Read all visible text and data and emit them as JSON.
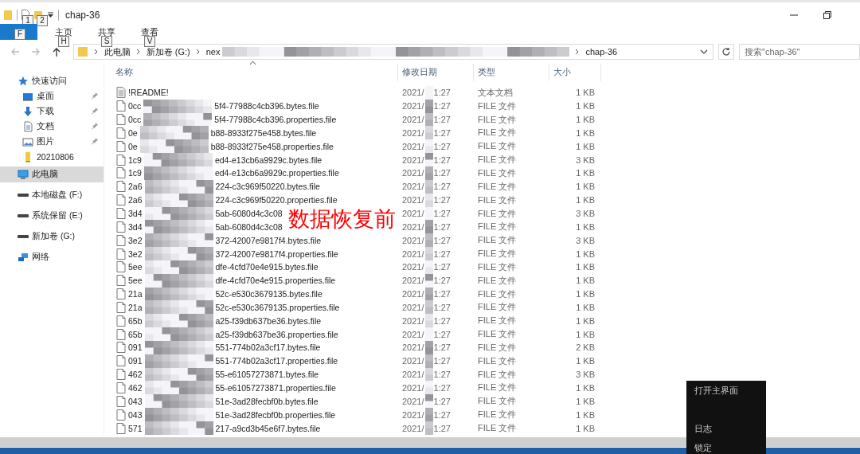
{
  "window": {
    "title": "chap-36",
    "quick_access_tips": [
      "1",
      "2"
    ]
  },
  "ribbon": {
    "tabs": [
      {
        "kind": "file",
        "key_tip": "F"
      },
      {
        "kind": "tab",
        "label": "主页",
        "key_tip": "H"
      },
      {
        "kind": "tab",
        "label": "共享",
        "key_tip": "S"
      },
      {
        "kind": "tab",
        "label": "查看",
        "key_tip": "V"
      }
    ]
  },
  "address": {
    "segments": [
      {
        "kind": "crumb",
        "label": "此电脑"
      },
      {
        "kind": "crumb",
        "label": "新加卷 (G:)"
      },
      {
        "kind": "cut",
        "label": "nex"
      },
      {
        "kind": "crumb",
        "label": "chap-36"
      }
    ],
    "search": {
      "placeholder": "搜索\"chap-36\""
    }
  },
  "sidebar": {
    "items": [
      {
        "kind": "star",
        "label": "快速访问",
        "pinned": false,
        "selected": false
      },
      {
        "kind": "desktop",
        "label": "桌面",
        "pinned": true,
        "selected": false
      },
      {
        "kind": "download",
        "label": "下载",
        "pinned": true,
        "selected": false
      },
      {
        "kind": "document",
        "label": "文档",
        "pinned": true,
        "selected": false
      },
      {
        "kind": "picture",
        "label": "图片",
        "pinned": true,
        "selected": false
      },
      {
        "kind": "folder",
        "label": "20210806",
        "pinned": false,
        "selected": false
      },
      {
        "kind": "pc",
        "label": "此电脑",
        "pinned": false,
        "selected": true
      },
      {
        "kind": "drive",
        "label": "本地磁盘 (F:)",
        "pinned": false,
        "selected": false
      },
      {
        "kind": "drive",
        "label": "系统保留 (E:)",
        "pinned": false,
        "selected": false
      },
      {
        "kind": "drive",
        "label": "新加卷 (G:)",
        "pinned": false,
        "selected": false
      },
      {
        "kind": "network",
        "label": "网络",
        "pinned": false,
        "selected": false
      }
    ]
  },
  "table": {
    "columns": [
      "名称",
      "修改日期",
      "类型",
      "大小"
    ],
    "rows": [
      {
        "kind": "text",
        "name": "!README!",
        "date": "2021/",
        "time": "1:27",
        "type": "文本文档",
        "size": "1 KB"
      },
      {
        "kind": "file",
        "name_start": "0cc",
        "name_end": "5f4-77988c4cb396.bytes.file",
        "date": "2021/",
        "time": "1:27",
        "type": "FILE 文件",
        "size": "1 KB"
      },
      {
        "kind": "file",
        "name_start": "0cc",
        "name_end": "5f4-77988c4cb396.properties.file",
        "date": "2021/",
        "time": "1:27",
        "type": "FILE 文件",
        "size": "1 KB"
      },
      {
        "kind": "file",
        "name_start": "0e",
        "name_end": "b88-8933f275e458.bytes.file",
        "date": "2021/",
        "time": "1:27",
        "type": "FILE 文件",
        "size": "1 KB"
      },
      {
        "kind": "file",
        "name_start": "0e",
        "name_end": "b88-8933f275e458.properties.file",
        "date": "2021/",
        "time": "1:27",
        "type": "FILE 文件",
        "size": "1 KB"
      },
      {
        "kind": "file",
        "name_start": "1c9",
        "name_end": "ed4-e13cb6a9929c.bytes.file",
        "date": "2021/",
        "time": "1:27",
        "type": "FILE 文件",
        "size": "3 KB"
      },
      {
        "kind": "file",
        "name_start": "1c9",
        "name_end": "ed4-e13cb6a9929c.properties.file",
        "date": "2021/",
        "time": "1:27",
        "type": "FILE 文件",
        "size": "1 KB"
      },
      {
        "kind": "file",
        "name_start": "2a6",
        "name_end": "224-c3c969f50220.bytes.file",
        "date": "2021/",
        "time": "1:27",
        "type": "FILE 文件",
        "size": "1 KB"
      },
      {
        "kind": "file",
        "name_start": "2a6",
        "name_end": "224-c3c969f50220.properties.file",
        "date": "2021/",
        "time": "1:27",
        "type": "FILE 文件",
        "size": "1 KB"
      },
      {
        "kind": "file",
        "name_start": "3d4",
        "name_end": "5ab-6080d4c3c08",
        "date": "2021/",
        "time": "1:27",
        "type": "FILE 文件",
        "size": "3 KB"
      },
      {
        "kind": "file",
        "name_start": "3d4",
        "name_end": "5ab-6080d4c3c08",
        "date": "2021/",
        "time": "1:27",
        "type": "FILE 文件",
        "size": "1 KB"
      },
      {
        "kind": "file",
        "name_start": "3e2",
        "name_end": "372-42007e9817f4.bytes.file",
        "date": "2021/",
        "time": "1:27",
        "type": "FILE 文件",
        "size": "3 KB"
      },
      {
        "kind": "file",
        "name_start": "3e2",
        "name_end": "372-42007e9817f4.properties.file",
        "date": "2021/",
        "time": "1:27",
        "type": "FILE 文件",
        "size": "1 KB"
      },
      {
        "kind": "file",
        "name_start": "5ee",
        "name_end": "dfe-4cfd70e4e915.bytes.file",
        "date": "2021/",
        "time": "1:27",
        "type": "FILE 文件",
        "size": "1 KB"
      },
      {
        "kind": "file",
        "name_start": "5ee",
        "name_end": "dfe-4cfd70e4e915.properties.file",
        "date": "2021/",
        "time": "1:27",
        "type": "FILE 文件",
        "size": "1 KB"
      },
      {
        "kind": "file",
        "name_start": "21a",
        "name_end": "52c-e530c3679135.bytes.file",
        "date": "2021/",
        "time": "1:27",
        "type": "FILE 文件",
        "size": "1 KB"
      },
      {
        "kind": "file",
        "name_start": "21a",
        "name_end": "52c-e530c3679135.properties.file",
        "date": "2021/",
        "time": "1:27",
        "type": "FILE 文件",
        "size": "1 KB"
      },
      {
        "kind": "file",
        "name_start": "65b",
        "name_end": "a25-f39db637be36.bytes.file",
        "date": "2021/",
        "time": "1:27",
        "type": "FILE 文件",
        "size": "1 KB"
      },
      {
        "kind": "file",
        "name_start": "65b",
        "name_end": "a25-f39db637be36.properties.file",
        "date": "2021/",
        "time": "1:27",
        "type": "FILE 文件",
        "size": "1 KB"
      },
      {
        "kind": "file",
        "name_start": "091",
        "name_end": "551-774b02a3cf17.bytes.file",
        "date": "2021/",
        "time": "1:27",
        "type": "FILE 文件",
        "size": "2 KB"
      },
      {
        "kind": "file",
        "name_start": "091",
        "name_end": "551-774b02a3cf17.properties.file",
        "date": "2021/",
        "time": "1:27",
        "type": "FILE 文件",
        "size": "1 KB"
      },
      {
        "kind": "file",
        "name_start": "462",
        "name_end": "55-e61057273871.bytes.file",
        "date": "2021/",
        "time": "1:27",
        "type": "FILE 文件",
        "size": "3 KB"
      },
      {
        "kind": "file",
        "name_start": "462",
        "name_end": "55-e61057273871.properties.file",
        "date": "2021/",
        "time": "1:27",
        "type": "FILE 文件",
        "size": "1 KB"
      },
      {
        "kind": "file",
        "name_start": "043",
        "name_end": "51e-3ad28fecbf0b.bytes.file",
        "date": "2021/",
        "time": "1:27",
        "type": "FILE 文件",
        "size": "1 KB"
      },
      {
        "kind": "file",
        "name_start": "043",
        "name_end": "51e-3ad28fecbf0b.properties.file",
        "date": "2021/",
        "time": "1:27",
        "type": "FILE 文件",
        "size": "1 KB"
      },
      {
        "kind": "file",
        "name_start": "571",
        "name_end": "217-a9cd3b45e6f7.bytes.file",
        "date": "2021/",
        "time": "1:27",
        "type": "FILE 文件",
        "size": "1 KB"
      }
    ]
  },
  "overlay_caption": "数据恢复前",
  "context_menu": {
    "items": [
      "打开主界面",
      "日志",
      "锁定"
    ]
  }
}
